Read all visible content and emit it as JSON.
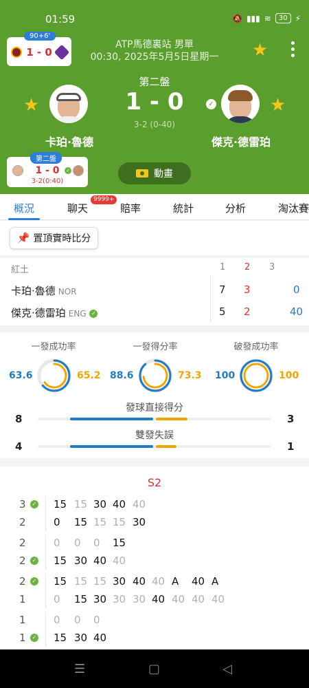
{
  "status_bar": {
    "time": "01:59",
    "battery": "30",
    "icons": [
      "mute-icon",
      "signal-icon",
      "wifi-icon",
      "battery-icon",
      "charging-icon"
    ]
  },
  "related_match": {
    "badge": "90+6'",
    "score": "1 - 0"
  },
  "event": {
    "title": "ATP馬德裏站 男單",
    "datetime": "00:30, 2025年5月5日星期一"
  },
  "set_label": "第二盤",
  "score": {
    "main": "1 - 0",
    "game": "3-2 (0-40)"
  },
  "players": {
    "left": {
      "name": "卡珀·魯德"
    },
    "right": {
      "name": "傑克·德雷珀"
    }
  },
  "set_card": {
    "badge": "第二盤",
    "score": "1 - 0",
    "sub": "3-2(0:40)"
  },
  "animation_button": "動畫",
  "tabs": [
    "概況",
    "聊天",
    "賠率",
    "統計",
    "分析",
    "淘汰賽"
  ],
  "chat_badge": "9999+",
  "pin_button": "置頂實時比分",
  "score_table": {
    "surface": "紅土",
    "set_headers": [
      "1",
      "2",
      "3"
    ],
    "rows": [
      {
        "name": "卡珀·魯德",
        "nation": "NOR",
        "sets": [
          "7",
          "3"
        ],
        "points": "0"
      },
      {
        "name": "傑克·德雷珀",
        "nation": "ENG",
        "sets": [
          "5",
          "2"
        ],
        "points": "40"
      }
    ]
  },
  "stats": {
    "circles": [
      {
        "title": "一發成功率",
        "left": "63.6",
        "right": "65.2",
        "left_value": 63.6,
        "right_value": 65.2
      },
      {
        "title": "一發得分率",
        "left": "88.6",
        "right": "73.3",
        "left_value": 88.6,
        "right_value": 73.3
      },
      {
        "title": "破發成功率",
        "left": "100",
        "right": "100",
        "left_value": 100,
        "right_value": 100
      }
    ],
    "bars": [
      {
        "title": "發球直接得分",
        "left": "8",
        "right": "3",
        "left_value": 8,
        "right_value": 3
      },
      {
        "title": "雙發失誤",
        "left": "4",
        "right": "1",
        "left_value": 4,
        "right_value": 1
      }
    ]
  },
  "colors": {
    "header_green": "#5a9e2d",
    "blue": "#1f7cc4",
    "orange": "#f0a500",
    "red": "#d93030",
    "star": "#f5c518"
  },
  "game_log": {
    "set_title": "S2",
    "games": [
      {
        "rows": [
          {
            "srv": "3",
            "check": true,
            "points": [
              [
                "15",
                false
              ],
              [
                "15",
                true
              ],
              [
                "30",
                false
              ],
              [
                "40",
                false
              ],
              [
                "40",
                true
              ]
            ]
          },
          {
            "srv": "2",
            "check": false,
            "points": [
              [
                "0",
                false
              ],
              [
                "15",
                false
              ],
              [
                "15",
                true
              ],
              [
                "15",
                true
              ],
              [
                "30",
                false
              ]
            ]
          }
        ]
      },
      {
        "rows": [
          {
            "srv": "2",
            "check": false,
            "points": [
              [
                "0",
                true
              ],
              [
                "0",
                true
              ],
              [
                "0",
                true
              ],
              [
                "15",
                false
              ]
            ]
          },
          {
            "srv": "2",
            "check": true,
            "points": [
              [
                "15",
                false
              ],
              [
                "30",
                false
              ],
              [
                "40",
                false
              ],
              [
                "40",
                true
              ]
            ]
          }
        ]
      },
      {
        "rows": [
          {
            "srv": "2",
            "check": true,
            "points": [
              [
                "15",
                false
              ],
              [
                "15",
                true
              ],
              [
                "15",
                true
              ],
              [
                "30",
                false
              ],
              [
                "40",
                false
              ],
              [
                "40",
                true
              ],
              [
                "A",
                false
              ],
              [
                "40",
                false
              ],
              [
                "A",
                false
              ]
            ]
          },
          {
            "srv": "1",
            "check": false,
            "points": [
              [
                "0",
                true
              ],
              [
                "15",
                false
              ],
              [
                "30",
                false
              ],
              [
                "30",
                true
              ],
              [
                "30",
                true
              ],
              [
                "40",
                false
              ],
              [
                "40",
                true
              ],
              [
                "40",
                true
              ],
              [
                "40",
                true
              ]
            ]
          }
        ]
      },
      {
        "rows": [
          {
            "srv": "1",
            "check": false,
            "points": [
              [
                "0",
                true
              ],
              [
                "0",
                true
              ],
              [
                "0",
                true
              ]
            ]
          },
          {
            "srv": "1",
            "check": true,
            "points": [
              [
                "15",
                false
              ],
              [
                "30",
                false
              ],
              [
                "40",
                false
              ]
            ]
          }
        ]
      }
    ]
  },
  "nav": [
    "menu-icon",
    "home-icon",
    "back-icon"
  ]
}
